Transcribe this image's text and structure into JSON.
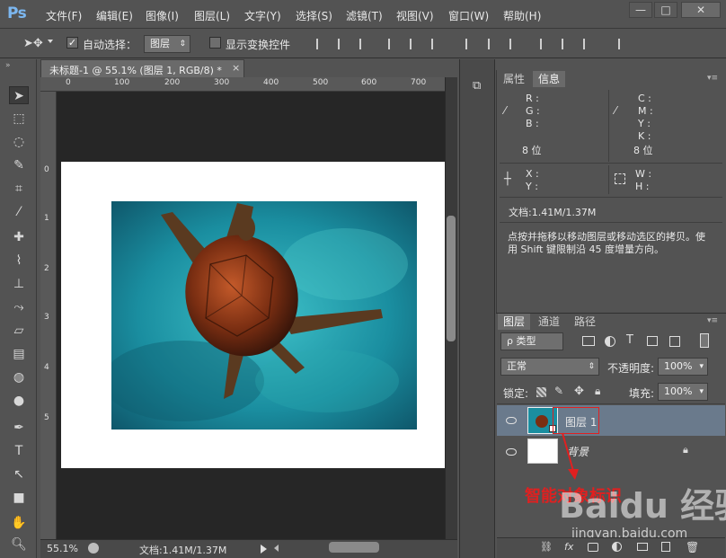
{
  "app": {
    "logo": "Ps",
    "menu": [
      "文件(F)",
      "编辑(E)",
      "图像(I)",
      "图层(L)",
      "文字(Y)",
      "选择(S)",
      "滤镜(T)",
      "视图(V)",
      "窗口(W)",
      "帮助(H)"
    ],
    "window_controls": {
      "minimize": "—",
      "maximize": "□",
      "close": "✕"
    }
  },
  "options_bar": {
    "auto_select_label": "自动选择：",
    "auto_select_checked": true,
    "auto_select_value": "图层",
    "show_transform_label": "显示变换控件",
    "show_transform_checked": false
  },
  "document": {
    "tab_title": "未标题-1 @ 55.1% (图层 1, RGB/8) *",
    "tab_close": "×",
    "ruler_top": [
      "0",
      "100",
      "200",
      "300",
      "400",
      "500",
      "600",
      "700"
    ],
    "ruler_left": [
      "0",
      "1",
      "2",
      "3",
      "4",
      "5"
    ]
  },
  "status": {
    "zoom": "55.1%",
    "doc_size": "文档:1.41M/1.37M"
  },
  "info_panel": {
    "tabs": [
      "属性",
      "信息"
    ],
    "active_tab": "信息",
    "rgb": {
      "r": "R :",
      "g": "G :",
      "b": "B :",
      "bits": "8 位"
    },
    "cmyk": {
      "c": "C :",
      "m": "M :",
      "y": "Y :",
      "k": "K :",
      "bits": "8 位"
    },
    "xy": {
      "x": "X :",
      "y": "Y :"
    },
    "wh": {
      "w": "W :",
      "h": "H :"
    },
    "doc_size": "文档:1.41M/1.37M",
    "hint": "点按并拖移以移动图层或移动选区的拷贝。使用 Shift 键限制沿 45 度增量方向。"
  },
  "layers_panel": {
    "tabs": [
      "图层",
      "通道",
      "路径"
    ],
    "active_tab": "图层",
    "filter_label": "ρ 类型",
    "blend_mode": "正常",
    "opacity_label": "不透明度:",
    "opacity_value": "100%",
    "lock_label": "锁定:",
    "fill_label": "填充:",
    "fill_value": "100%",
    "layers": [
      {
        "name": "图层 1",
        "smart_object": true,
        "selected": true
      },
      {
        "name": "背景",
        "smart_object": false,
        "selected": false,
        "locked": true
      }
    ]
  },
  "annotation": {
    "text": "智能对象标识",
    "color": "#e02020"
  },
  "watermark": {
    "brand": "Baidu 经验",
    "url": "jingyan.baidu.com"
  },
  "colors": {
    "accent_blue": "#7cb7f0",
    "annotation_red": "#e02020"
  }
}
